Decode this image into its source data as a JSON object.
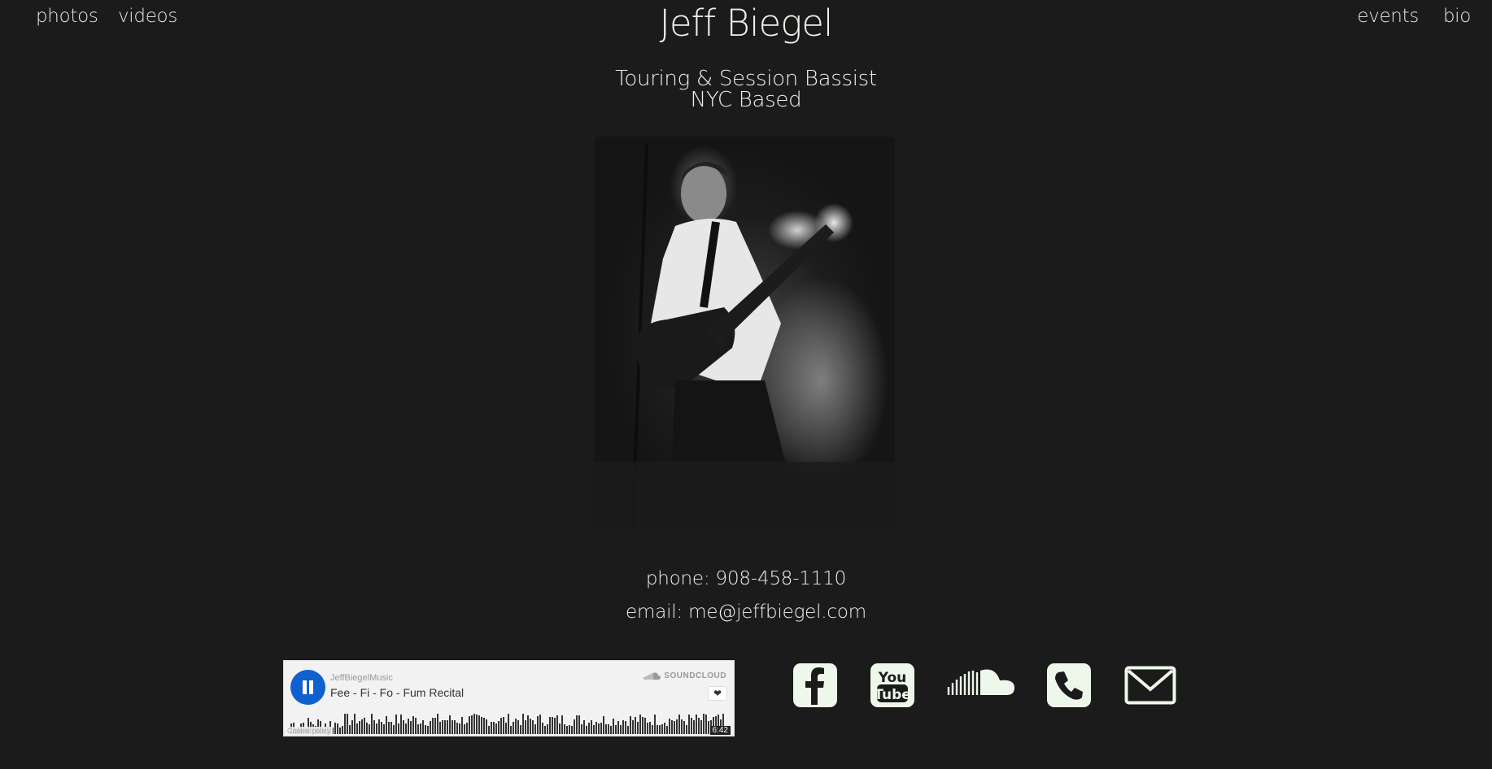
{
  "nav": {
    "left": [
      "photos",
      "videos"
    ],
    "right": [
      "events",
      "bio"
    ]
  },
  "header": {
    "title": "Jeff Biegel",
    "tagline_line1": "Touring & Session Bassist",
    "tagline_line2": "NYC Based"
  },
  "contact": {
    "phone": "phone: 908-458-1110",
    "email": "email: me@jeffbiegel.com"
  },
  "player": {
    "user": "JeffBiegelMusic",
    "track": "Fee - Fi - Fo - Fum Recital",
    "brand": "SOUNDCLOUD",
    "cookie": "Cookie policy",
    "duration": "6:42",
    "state": "playing",
    "accent": "#1060d0"
  },
  "social_icons": [
    "facebook-icon",
    "youtube-icon",
    "soundcloud-icon",
    "phone-icon",
    "email-icon"
  ],
  "colors": {
    "background": "#1b1b1b",
    "text": "#f1efea",
    "icon": "#eef8ea"
  }
}
